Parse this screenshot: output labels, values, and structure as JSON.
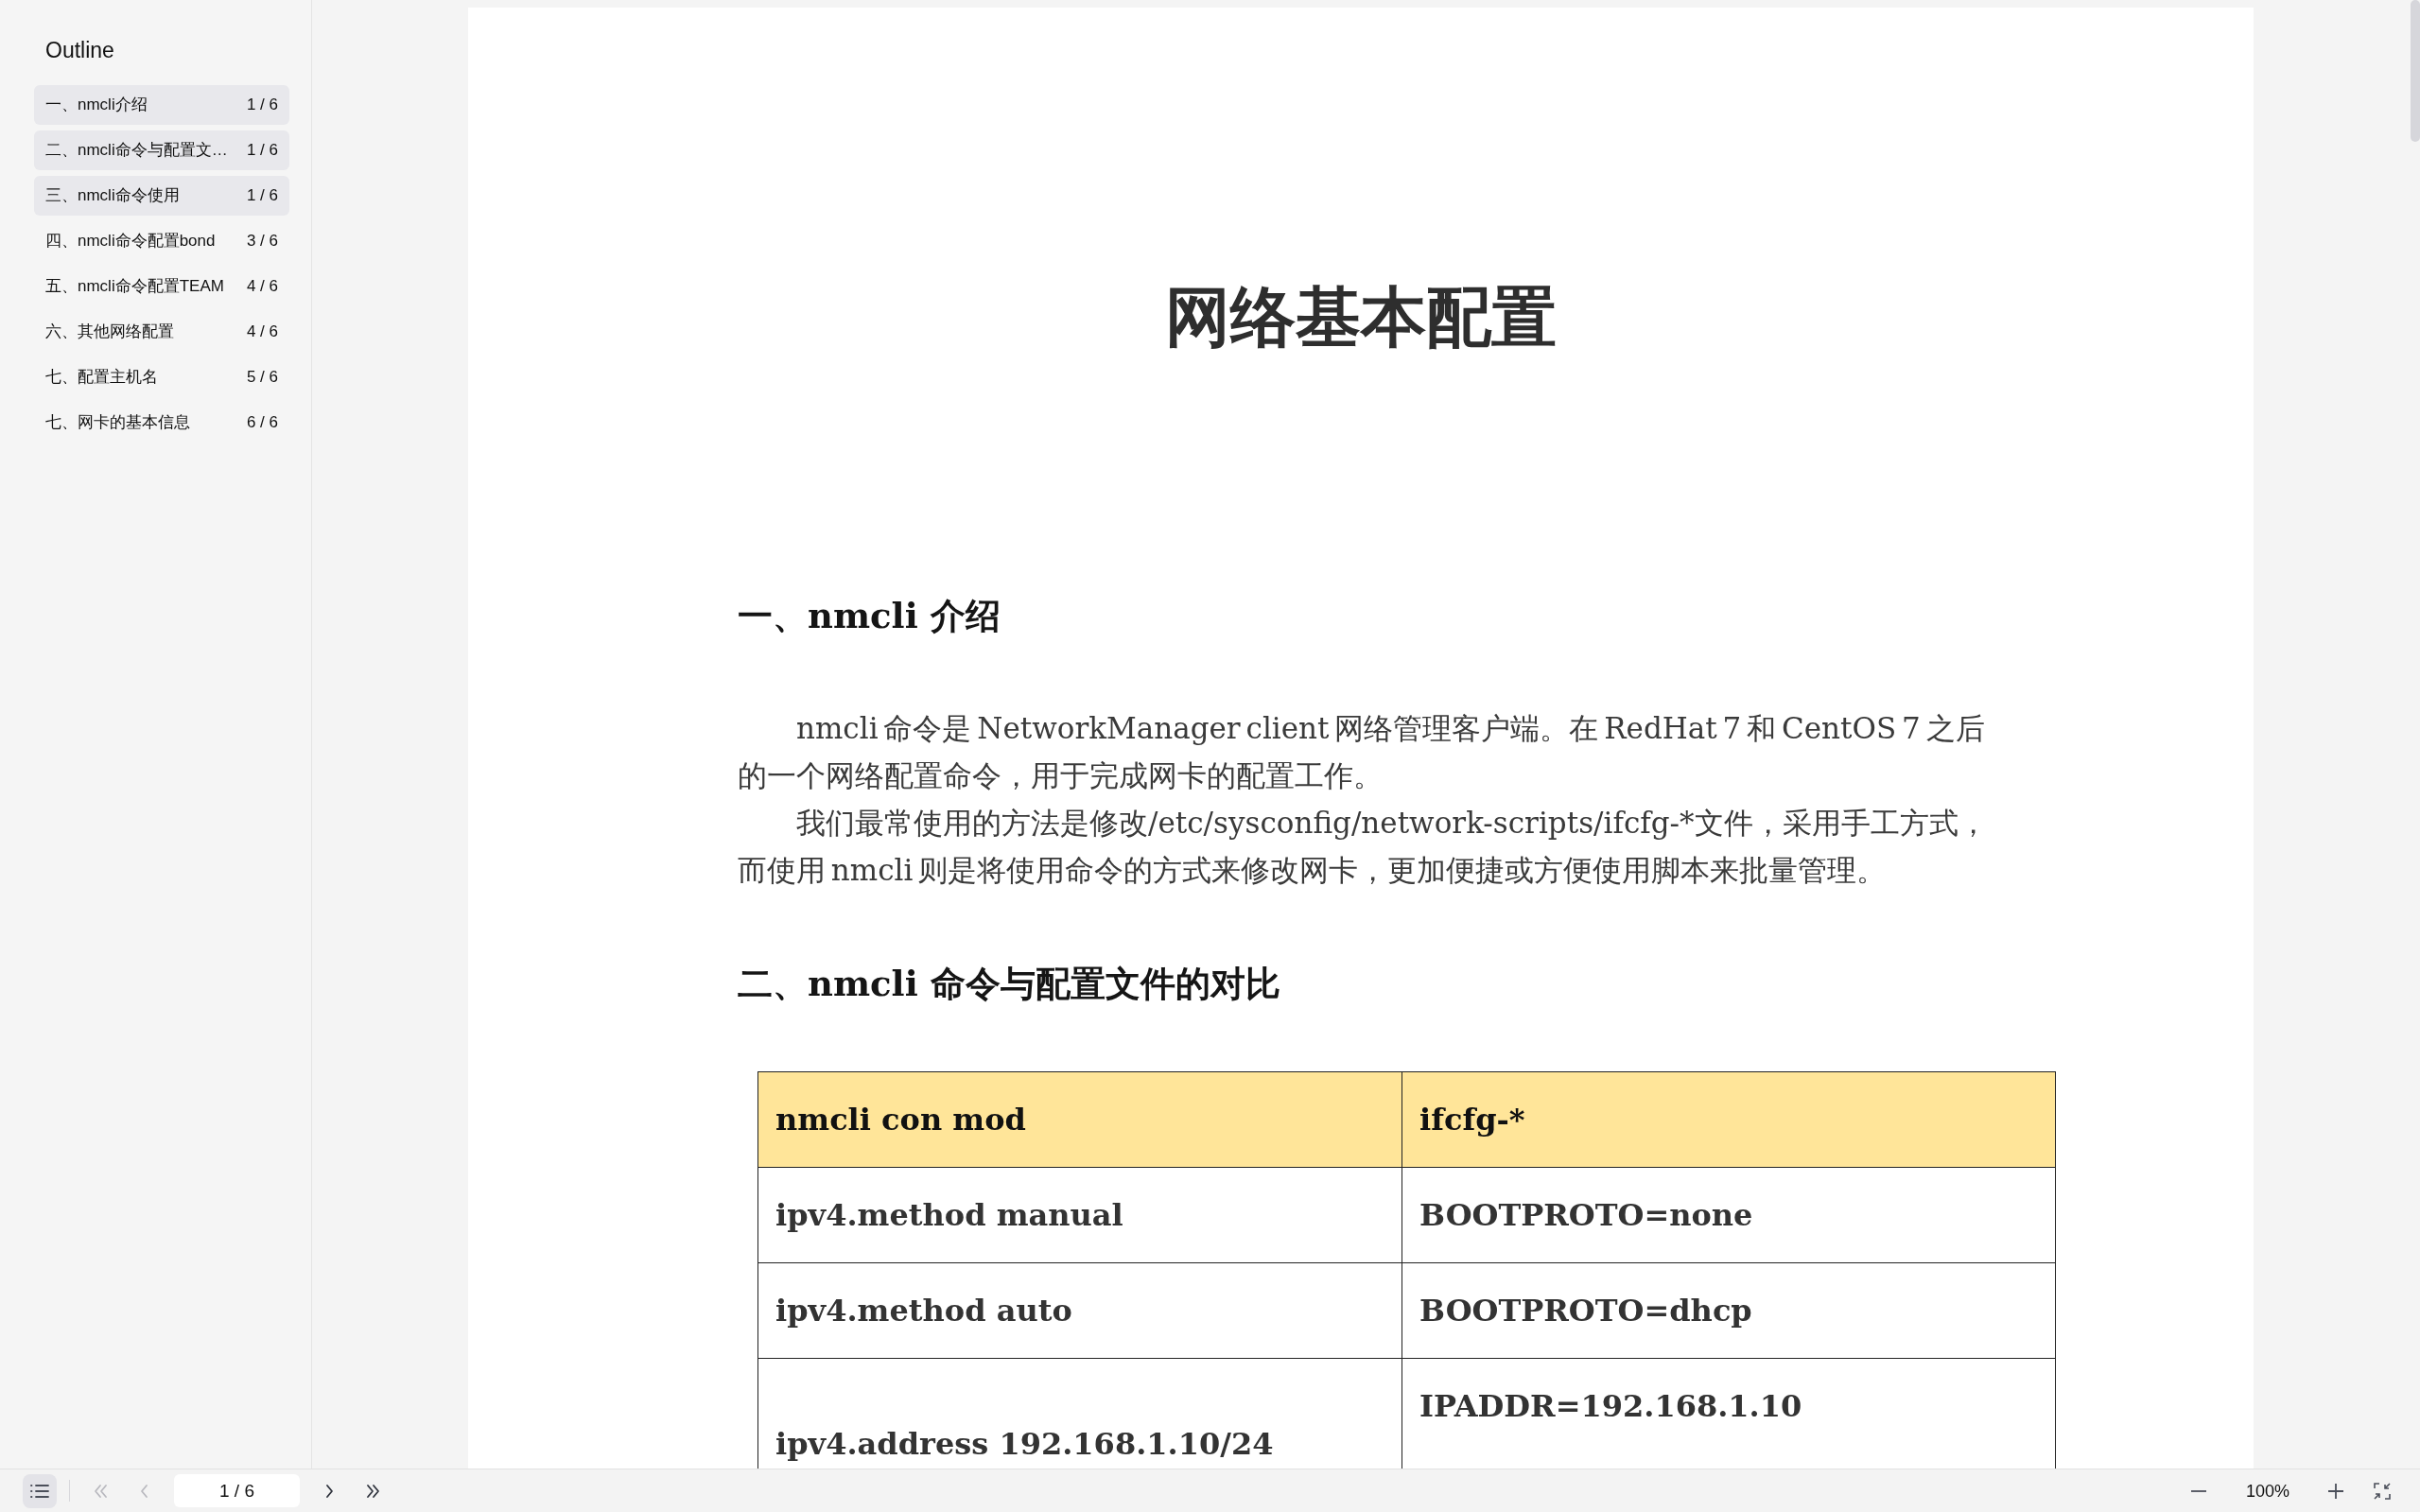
{
  "sidebar": {
    "title": "Outline",
    "items": [
      {
        "label": "一、nmcli介绍",
        "page": "1 / 6",
        "selected": true
      },
      {
        "label": "二、nmcli命令与配置文…",
        "page": "1 / 6",
        "selected": true
      },
      {
        "label": "三、nmcli命令使用",
        "page": "1 / 6",
        "selected": true
      },
      {
        "label": "四、nmcli命令配置bond",
        "page": "3 / 6",
        "selected": false
      },
      {
        "label": "五、nmcli命令配置TEAM",
        "page": "4 / 6",
        "selected": false
      },
      {
        "label": "六、其他网络配置",
        "page": "4 / 6",
        "selected": false
      },
      {
        "label": "七、配置主机名",
        "page": "5 / 6",
        "selected": false
      },
      {
        "label": "七、网卡的基本信息",
        "page": "6 / 6",
        "selected": false
      }
    ]
  },
  "document": {
    "title": "网络基本配置",
    "sections": [
      {
        "heading": "一、nmcli 介绍",
        "paragraphs": [
          "nmcli 命令是 NetworkManager client 网络管理客户端。在 RedHat 7 和 CentOS 7 之后的一个网络配置命令，用于完成网卡的配置工作。",
          "我们最常使用的方法是修改/etc/sysconfig/network-scripts/ifcfg-*文件，采用手工方式，而使用 nmcli 则是将使用命令的方式来修改网卡，更加便捷或方便使用脚本来批量管理。"
        ]
      },
      {
        "heading": "二、nmcli 命令与配置文件的对比",
        "table": {
          "columns": [
            "nmcli con mod",
            "ifcfg-*"
          ],
          "rows": [
            [
              "ipv4.method manual",
              "BOOTPROTO=none"
            ],
            [
              "ipv4.method auto",
              "BOOTPROTO=dhcp"
            ],
            [
              "ipv4.address 192.168.1.10/24",
              "IPADDR=192.168.1.10"
            ]
          ]
        }
      }
    ]
  },
  "toolbar": {
    "outline_toggle": {
      "on": true
    },
    "navigation": [
      {
        "kind": "first",
        "disabled": true
      },
      {
        "kind": "previous",
        "disabled": true
      },
      {
        "kind": "page",
        "value": "1 / 6",
        "disabled": false
      },
      {
        "kind": "next",
        "disabled": false
      },
      {
        "kind": "last",
        "disabled": false
      }
    ],
    "zoom": {
      "value": "100%"
    }
  }
}
